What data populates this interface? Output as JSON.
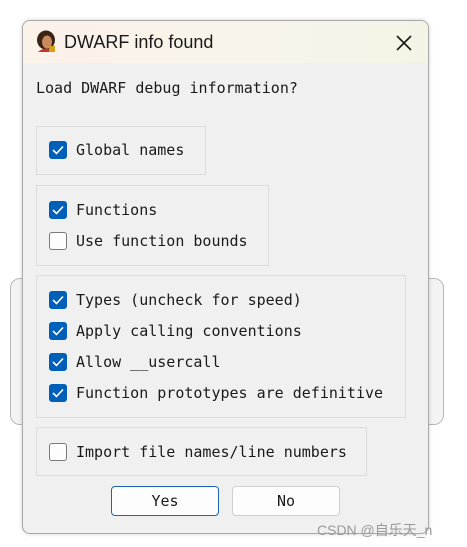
{
  "dialog": {
    "title": "DWARF info found",
    "prompt": "Load DWARF debug information?"
  },
  "groups": [
    {
      "options": [
        {
          "label": "Global names",
          "checked": true
        }
      ]
    },
    {
      "options": [
        {
          "label": "Functions",
          "checked": true
        },
        {
          "label": "Use function bounds",
          "checked": false
        }
      ]
    },
    {
      "options": [
        {
          "label": "Types (uncheck for speed)",
          "checked": true
        },
        {
          "label": "Apply calling conventions",
          "checked": true
        },
        {
          "label": "Allow __usercall",
          "checked": true
        },
        {
          "label": "Function prototypes are definitive",
          "checked": true
        }
      ]
    },
    {
      "options": [
        {
          "label": "Import file names/line numbers",
          "checked": false
        }
      ]
    }
  ],
  "buttons": {
    "yes": "Yes",
    "no": "No"
  },
  "watermark": "CSDN @自乐天_n",
  "colors": {
    "accent": "#005fb8",
    "dialog_bg": "#f0f0f0"
  }
}
